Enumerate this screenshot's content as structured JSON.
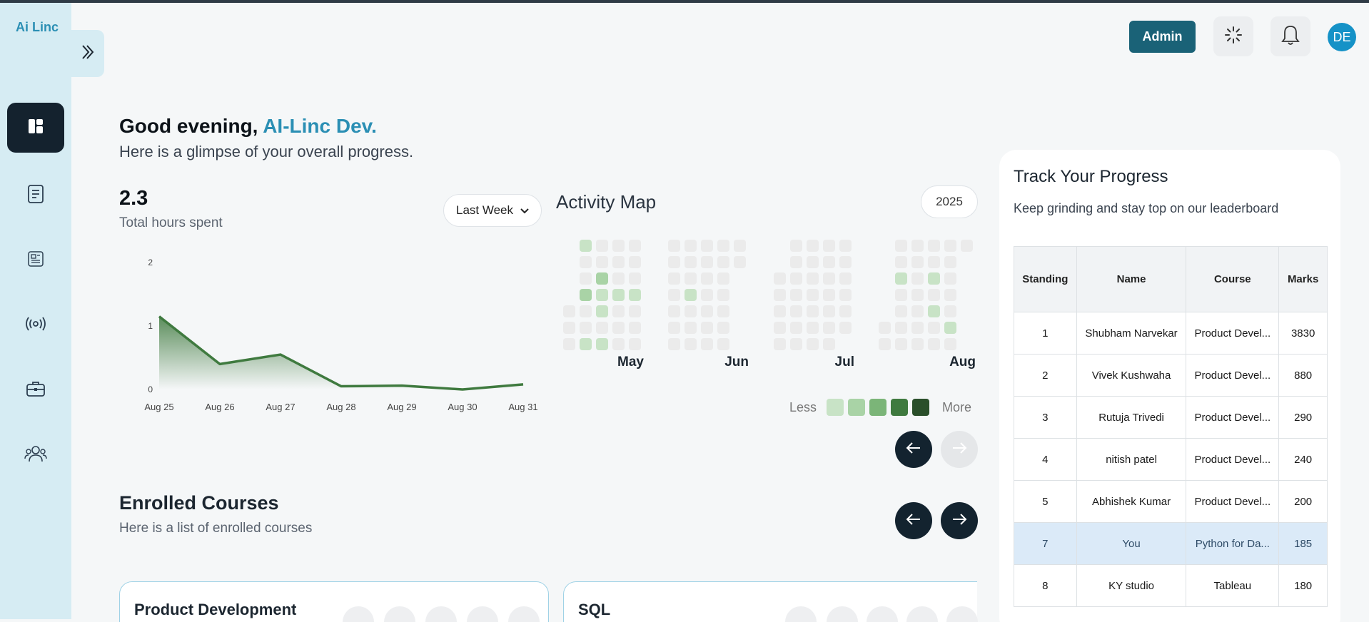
{
  "app": {
    "logo": "Ai Linc"
  },
  "header": {
    "admin_label": "Admin",
    "avatar_initials": "DE"
  },
  "greeting": {
    "prefix": "Good evening, ",
    "name": "AI-Linc Dev.",
    "subtitle": "Here is a glimpse of your overall progress."
  },
  "hours": {
    "value": "2.3",
    "label": "Total hours spent",
    "period": "Last Week"
  },
  "chart_data": {
    "type": "area",
    "categories": [
      "Aug 25",
      "Aug 26",
      "Aug 27",
      "Aug 28",
      "Aug 29",
      "Aug 30",
      "Aug 31"
    ],
    "values": [
      1.15,
      0.4,
      0.55,
      0.05,
      0.06,
      0.0,
      0.08
    ],
    "ylim": [
      0,
      2
    ],
    "yticks": [
      "0",
      "1",
      "2"
    ],
    "color": "#3f7a3f",
    "grid": false
  },
  "activity_map": {
    "title": "Activity Map",
    "year": "2025",
    "months": [
      "May",
      "Jun",
      "Jul",
      "Aug"
    ],
    "legend_less": "Less",
    "legend_more": "More",
    "legend_colors": [
      "#c8e3c6",
      "#a9d3a6",
      "#7bb578",
      "#3f7a3f",
      "#2a4f2a"
    ],
    "empty_color": "#ebebeb"
  },
  "enrolled": {
    "title": "Enrolled Courses",
    "subtitle": "Here is a list of enrolled courses",
    "courses": [
      {
        "name": "Product Development"
      },
      {
        "name": "SQL"
      }
    ]
  },
  "progress": {
    "title": "Track Your Progress",
    "subtitle": "Keep grinding and stay top on our leaderboard",
    "columns": [
      "Standing",
      "Name",
      "Course",
      "Marks"
    ],
    "rows": [
      {
        "standing": "1",
        "name": "Shubham Narvekar",
        "course": "Product Devel...",
        "marks": "3830"
      },
      {
        "standing": "2",
        "name": "Vivek Kushwaha",
        "course": "Product Devel...",
        "marks": "880"
      },
      {
        "standing": "3",
        "name": "Rutuja Trivedi",
        "course": "Product Devel...",
        "marks": "290"
      },
      {
        "standing": "4",
        "name": "nitish patel",
        "course": "Product Devel...",
        "marks": "240"
      },
      {
        "standing": "5",
        "name": "Abhishek Kumar",
        "course": "Product Devel...",
        "marks": "200"
      },
      {
        "standing": "7",
        "name": "You",
        "course": "Python for Da...",
        "marks": "185",
        "highlight": true
      },
      {
        "standing": "8",
        "name": "KY studio",
        "course": "Tableau",
        "marks": "180"
      }
    ]
  },
  "icons": {
    "collapse": "chevrons-right-icon",
    "dashboard": "dashboard-icon",
    "notes": "document-icon",
    "article": "article-icon",
    "live": "broadcast-icon",
    "jobs": "briefcase-icon",
    "community": "community-icon",
    "loader": "loader-icon",
    "bell": "bell-icon"
  }
}
